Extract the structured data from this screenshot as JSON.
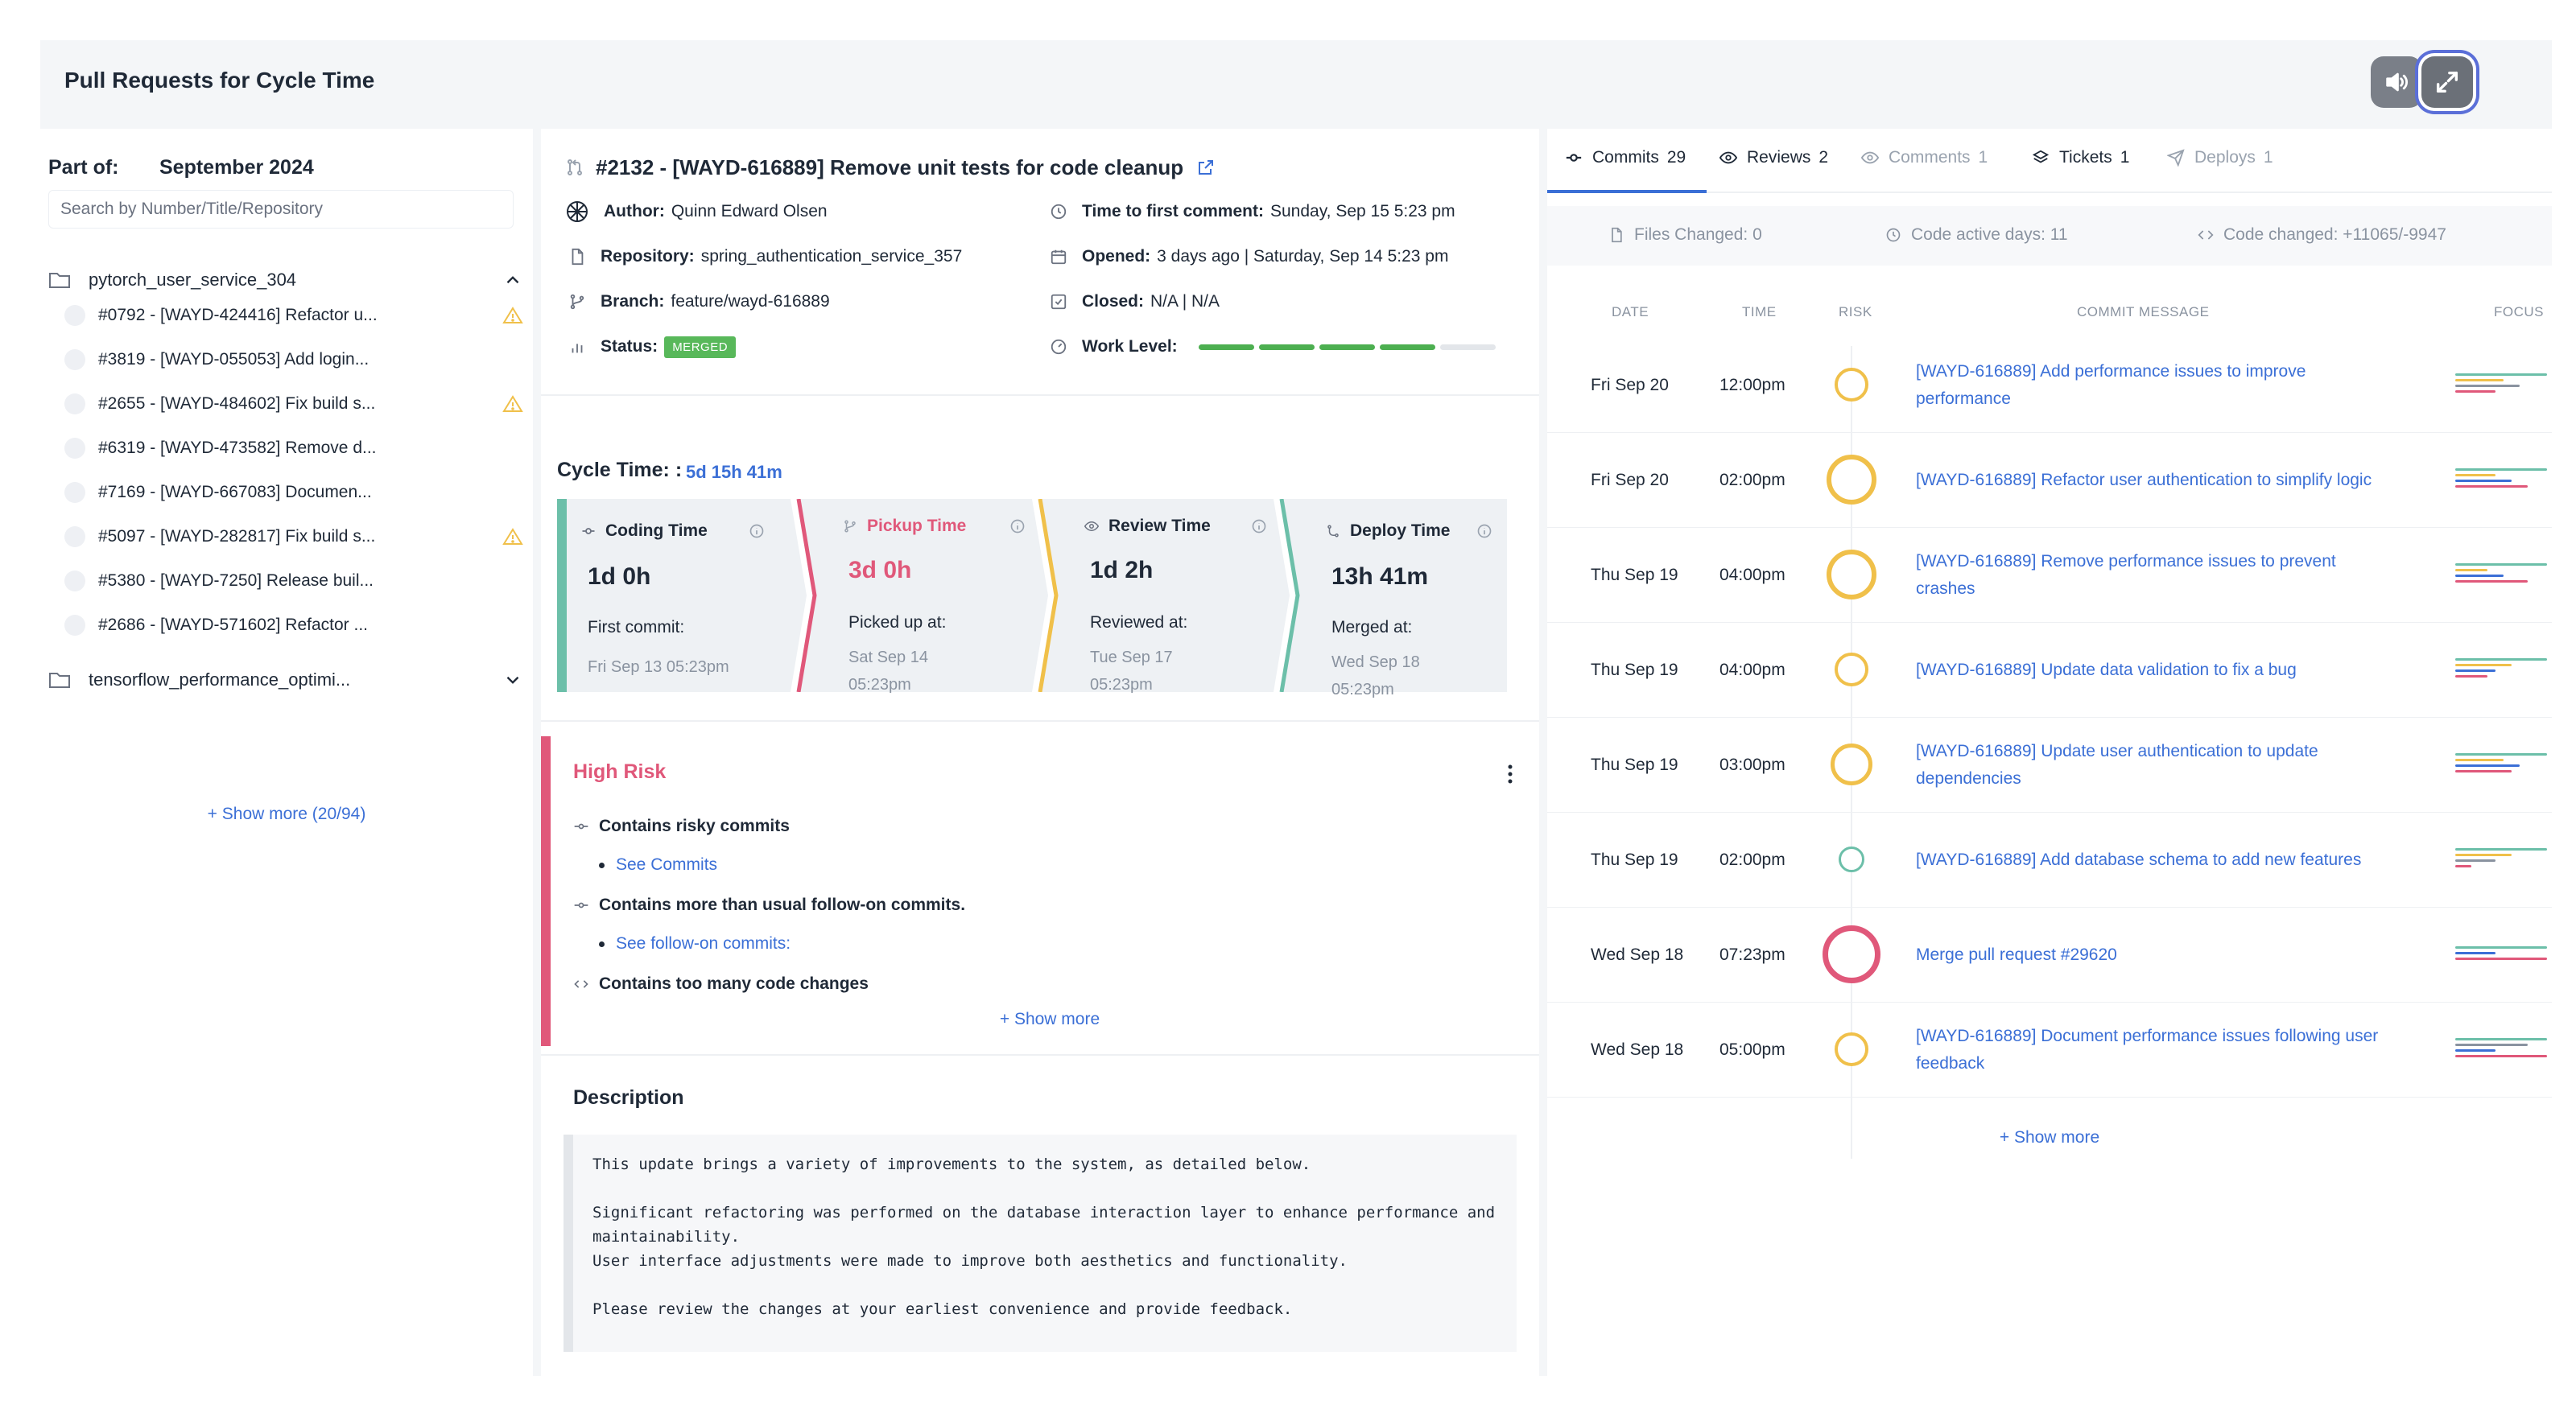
{
  "header": {
    "title": "Pull Requests for Cycle Time"
  },
  "left": {
    "part_label": "Part of:",
    "part_value": "September 2024",
    "search_placeholder": "Search by Number/Title/Repository",
    "repos": [
      {
        "name": "pytorch_user_service_304",
        "expanded": true,
        "items": [
          {
            "label": "#0792 - [WAYD-424416] Refactor u...",
            "warning": true
          },
          {
            "label": "#3819 - [WAYD-055053] Add login...",
            "warning": false
          },
          {
            "label": "#2655 - [WAYD-484602] Fix build s...",
            "warning": true
          },
          {
            "label": "#6319 - [WAYD-473582] Remove d...",
            "warning": false
          },
          {
            "label": "#7169 - [WAYD-667083] Documen...",
            "warning": false
          },
          {
            "label": "#5097 - [WAYD-282817] Fix build s...",
            "warning": true
          },
          {
            "label": "#5380 - [WAYD-7250] Release buil...",
            "warning": false
          },
          {
            "label": "#2686 - [WAYD-571602] Refactor ...",
            "warning": false
          }
        ]
      },
      {
        "name": "tensorflow_performance_optimi...",
        "expanded": false,
        "items": []
      }
    ],
    "show_more": "+ Show more (20/94)"
  },
  "pr": {
    "title": "#2132 - [WAYD-616889] Remove unit tests for code cleanup",
    "author_label": "Author:",
    "author": "Quinn Edward Olsen",
    "repository_label": "Repository:",
    "repository": "spring_authentication_service_357",
    "branch_label": "Branch:",
    "branch": "feature/wayd-616889",
    "status_label": "Status:",
    "status": "MERGED",
    "first_comment_label": "Time to first comment:",
    "first_comment": "Sunday, Sep 15 5:23 pm",
    "opened_label": "Opened:",
    "opened": "3 days ago | Saturday, Sep 14 5:23 pm",
    "closed_label": "Closed:",
    "closed": "N/A | N/A",
    "work_level_label": "Work Level:",
    "work_level": 0.8
  },
  "cycle": {
    "label": "Cycle Time: :",
    "value": "5d 15h 41m",
    "stages": [
      {
        "name": "Coding Time",
        "duration": "1d 0h",
        "sub": "First commit:",
        "date": "Fri Sep 13 05:23pm",
        "color": "#6cbfa9",
        "name_color": "#1f2937"
      },
      {
        "name": "Pickup Time",
        "duration": "3d 0h",
        "sub": "Picked up at:",
        "date": "Sat Sep 14 05:23pm",
        "color": "#e0587a",
        "name_color": "#e0587a"
      },
      {
        "name": "Review Time",
        "duration": "1d 2h",
        "sub": "Reviewed at:",
        "date": "Tue Sep 17 05:23pm",
        "color": "#f0c04a",
        "name_color": "#1f2937"
      },
      {
        "name": "Deploy Time",
        "duration": "13h 41m",
        "sub": "Merged at:",
        "date": "Wed Sep 18 05:23pm",
        "color": "#6cbfa9",
        "name_color": "#1f2937"
      }
    ]
  },
  "risk": {
    "title": "High Risk",
    "items": [
      {
        "text": "Contains risky commits",
        "link": "See Commits"
      },
      {
        "text": "Contains more than usual follow-on commits.",
        "link": "See follow-on commits:"
      },
      {
        "text": "Contains too many code changes",
        "link": ""
      }
    ],
    "show_more": "+ Show more"
  },
  "description": {
    "title": "Description",
    "p1": "This update brings a variety of improvements to the system, as detailed below.",
    "p2a": "Significant refactoring was performed on the database interaction layer to enhance performance and maintainability.",
    "p2b": "User interface adjustments were made to improve both aesthetics and functionality.",
    "p3": "Please review the changes at your earliest convenience and provide feedback."
  },
  "right": {
    "tabs": [
      {
        "label": "Commits",
        "count": "29",
        "active": true,
        "icon": "commit-icon"
      },
      {
        "label": "Reviews",
        "count": "2",
        "active": false,
        "icon": "eye-icon"
      },
      {
        "label": "Comments",
        "count": "1",
        "active": false,
        "icon": "comment-icon"
      },
      {
        "label": "Tickets",
        "count": "1",
        "active": false,
        "icon": "layers-icon"
      },
      {
        "label": "Deploys",
        "count": "1",
        "active": false,
        "icon": "send-icon"
      }
    ],
    "stats": {
      "files_changed": "Files Changed: 0",
      "active_days": "Code active days: 11",
      "code_changed": "Code changed: +11065/-9947"
    },
    "columns": {
      "date": "DATE",
      "time": "TIME",
      "risk": "RISK",
      "message": "COMMIT MESSAGE",
      "focus": "FOCUS"
    },
    "commits": [
      {
        "date": "Fri Sep 20",
        "time": "12:00pm",
        "message": "[WAYD-616889] Add performance issues to improve performance",
        "risk_level": 2,
        "risk_color": "#f0c04a"
      },
      {
        "date": "Fri Sep 20",
        "time": "02:00pm",
        "message": "[WAYD-616889] Refactor user authentication to simplify logic",
        "risk_level": 4,
        "risk_color": "#f0c04a"
      },
      {
        "date": "Thu Sep 19",
        "time": "04:00pm",
        "message": "[WAYD-616889] Remove performance issues to prevent crashes",
        "risk_level": 4,
        "risk_color": "#f0c04a"
      },
      {
        "date": "Thu Sep 19",
        "time": "04:00pm",
        "message": "[WAYD-616889] Update data validation to fix a bug",
        "risk_level": 2,
        "risk_color": "#f0c04a"
      },
      {
        "date": "Thu Sep 19",
        "time": "03:00pm",
        "message": "[WAYD-616889] Update user authentication to update dependencies",
        "risk_level": 3,
        "risk_color": "#f0c04a"
      },
      {
        "date": "Thu Sep 19",
        "time": "02:00pm",
        "message": "[WAYD-616889] Add database schema to add new features",
        "risk_level": 1,
        "risk_color": "#6cbfa9"
      },
      {
        "date": "Wed Sep 18",
        "time": "07:23pm",
        "message": "Merge pull request #29620",
        "risk_level": 5,
        "risk_color": "#e0587a"
      },
      {
        "date": "Wed Sep 18",
        "time": "05:00pm",
        "message": "[WAYD-616889] Document performance issues following user feedback",
        "risk_level": 2,
        "risk_color": "#f0c04a"
      }
    ],
    "show_more": "+ Show more"
  },
  "colors": {
    "accent": "#3b6fd6",
    "risk_high": "#e0587a",
    "warning": "#f0c04a",
    "success": "#58b85a",
    "teal": "#6cbfa9"
  }
}
